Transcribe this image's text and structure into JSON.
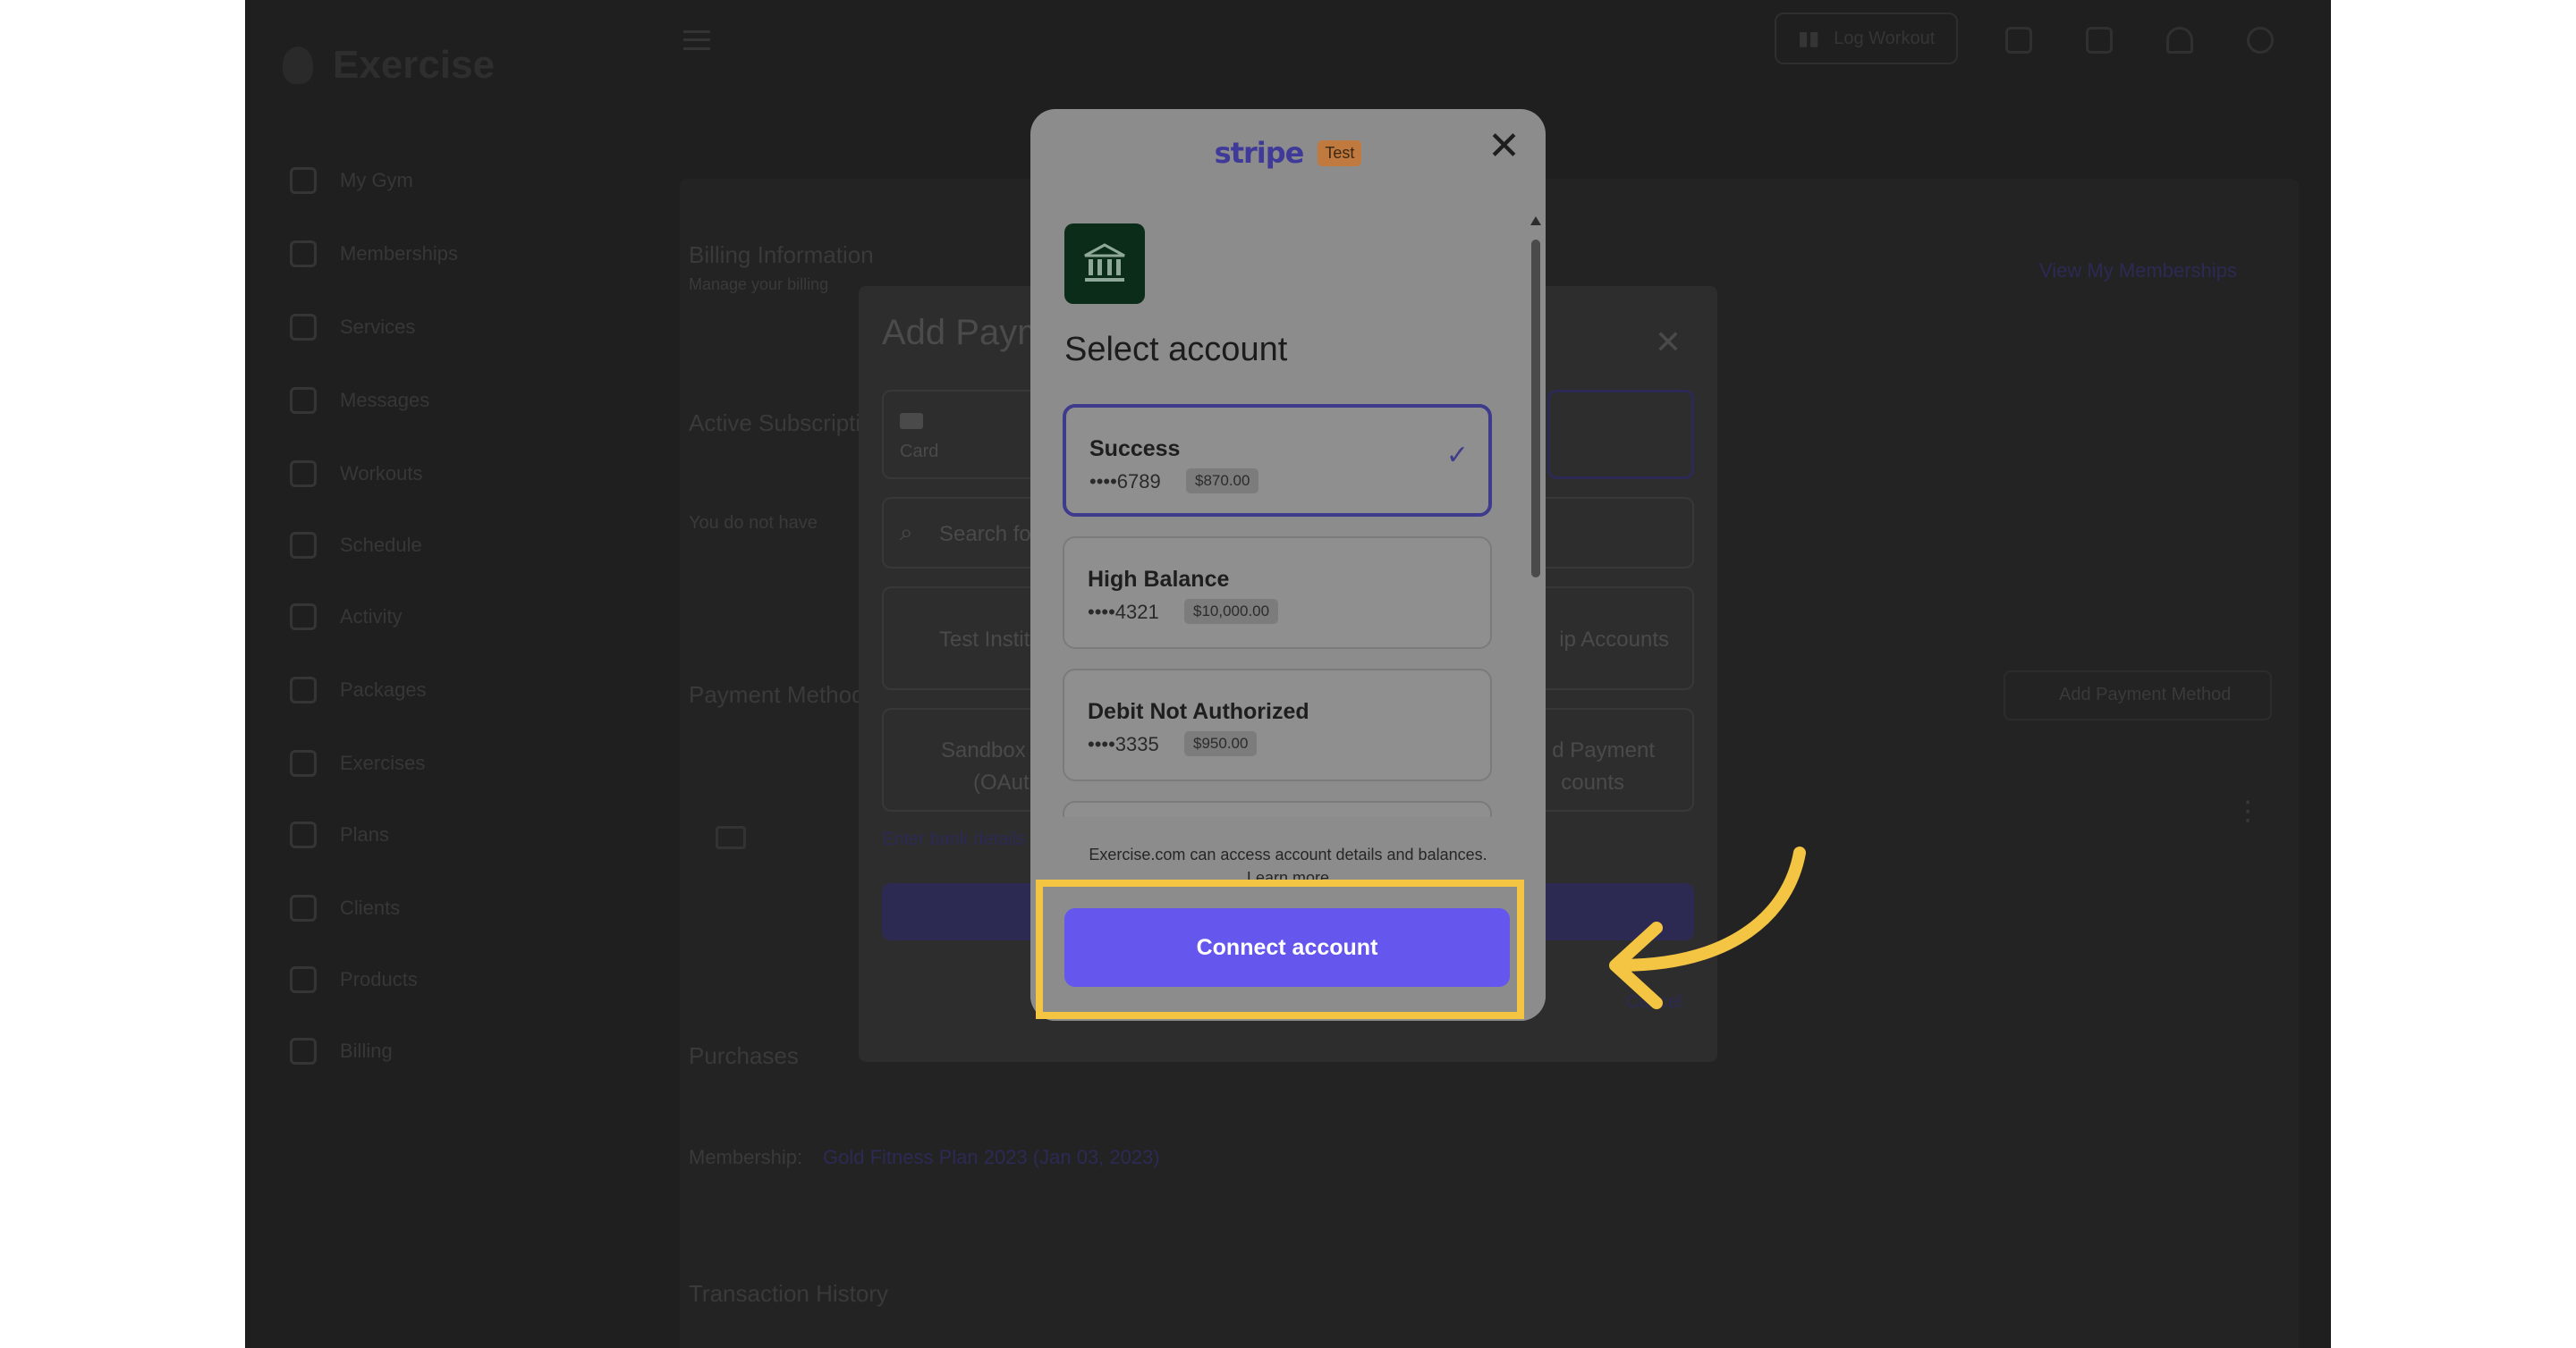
{
  "app": {
    "brand": "Exercise",
    "sidebar": [
      {
        "label": "My Gym",
        "icon": "home-icon"
      },
      {
        "label": "Memberships",
        "icon": "card-icon"
      },
      {
        "label": "Services",
        "icon": "list-icon"
      },
      {
        "label": "Messages",
        "icon": "mail-icon"
      },
      {
        "label": "Workouts",
        "icon": "laptop-icon"
      },
      {
        "label": "Schedule",
        "icon": "calendar-icon"
      },
      {
        "label": "Activity",
        "icon": "activity-icon"
      },
      {
        "label": "Packages",
        "icon": "package-icon"
      },
      {
        "label": "Exercises",
        "icon": "dumbbell-icon"
      },
      {
        "label": "Plans",
        "icon": "plan-icon"
      },
      {
        "label": "Clients",
        "icon": "users-icon"
      },
      {
        "label": "Products",
        "icon": "product-icon"
      },
      {
        "label": "Billing",
        "icon": "billing-icon"
      }
    ],
    "top_button_label": "Log Workout",
    "page_sections": {
      "billing_title": "Billing Information",
      "billing_subtitle": "Manage your billing",
      "view_link": "View My Memberships",
      "active_subs": "Active Subscriptions",
      "none_text": "You do not have",
      "payment_methods": "Payment Methods",
      "add_method": "Add Payment Method",
      "purchases": "Purchases",
      "membership_label": "Membership:",
      "membership_value": "Gold Fitness Plan 2023 (Jan 03, 2023)",
      "transaction_history": "Transaction History"
    }
  },
  "add_payment_dialog": {
    "title": "Add Payment",
    "card_tab": "Card",
    "search_placeholder": "Search for",
    "tile_left_1": "Test Institu",
    "tile_right_1": "ip Accounts",
    "tile_left_2": "Sandbox",
    "tile_left_2b": "(OAuth",
    "tile_right_2": "d Payment",
    "tile_right_2b": "counts",
    "enter_bank_link": "Enter bank details",
    "cancel": "Cancel"
  },
  "stripe_modal": {
    "brand": "stripe",
    "badge": "Test",
    "title": "Select account",
    "accounts": [
      {
        "name": "Success",
        "mask": "••••6789",
        "balance": "$870.00",
        "selected": true
      },
      {
        "name": "High Balance",
        "mask": "••••4321",
        "balance": "$10,000.00",
        "selected": false
      },
      {
        "name": "Debit Not Authorized",
        "mask": "••••3335",
        "balance": "$950.00",
        "selected": false
      }
    ],
    "consent": "Exercise.com can access account details and balances.",
    "learn_more": "Learn more",
    "connect_button": "Connect account"
  },
  "colors": {
    "accent": "#6557ee",
    "highlight": "#f4c542",
    "bank_icon_bg": "#0b2c18"
  }
}
